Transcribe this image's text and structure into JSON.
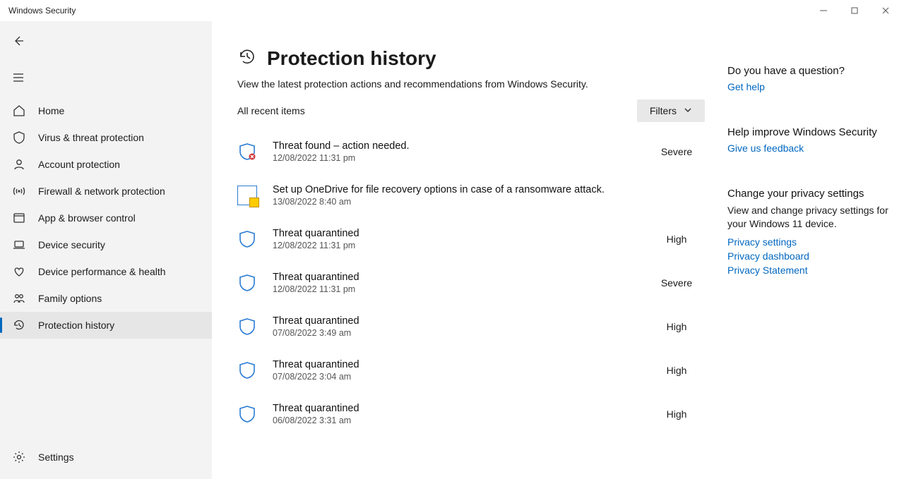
{
  "window": {
    "title": "Windows Security"
  },
  "sidebar": {
    "items": [
      {
        "label": "Home"
      },
      {
        "label": "Virus & threat protection"
      },
      {
        "label": "Account protection"
      },
      {
        "label": "Firewall & network protection"
      },
      {
        "label": "App & browser control"
      },
      {
        "label": "Device security"
      },
      {
        "label": "Device performance & health"
      },
      {
        "label": "Family options"
      },
      {
        "label": "Protection history"
      }
    ],
    "settings_label": "Settings"
  },
  "page": {
    "title": "Protection history",
    "subtitle": "View the latest protection actions and recommendations from Windows Security.",
    "list_label": "All recent items",
    "filters_label": "Filters"
  },
  "events": [
    {
      "icon": "shield-alert",
      "title": "Threat found – action needed.",
      "time": "12/08/2022 11:31 pm",
      "severity": "Severe"
    },
    {
      "icon": "onedrive",
      "title": "Set up OneDrive for file recovery options in case of a ransomware attack.",
      "time": "13/08/2022 8:40 am",
      "severity": ""
    },
    {
      "icon": "shield",
      "title": "Threat quarantined",
      "time": "12/08/2022 11:31 pm",
      "severity": "High"
    },
    {
      "icon": "shield",
      "title": "Threat quarantined",
      "time": "12/08/2022 11:31 pm",
      "severity": "Severe"
    },
    {
      "icon": "shield",
      "title": "Threat quarantined",
      "time": "07/08/2022 3:49 am",
      "severity": "High"
    },
    {
      "icon": "shield",
      "title": "Threat quarantined",
      "time": "07/08/2022 3:04 am",
      "severity": "High"
    },
    {
      "icon": "shield",
      "title": "Threat quarantined",
      "time": "06/08/2022 3:31 am",
      "severity": "High"
    }
  ],
  "right": {
    "question": {
      "title": "Do you have a question?",
      "link": "Get help"
    },
    "improve": {
      "title": "Help improve Windows Security",
      "link": "Give us feedback"
    },
    "privacy": {
      "title": "Change your privacy settings",
      "desc": "View and change privacy settings for your Windows 11 device.",
      "links": [
        "Privacy settings",
        "Privacy dashboard",
        "Privacy Statement"
      ]
    }
  }
}
